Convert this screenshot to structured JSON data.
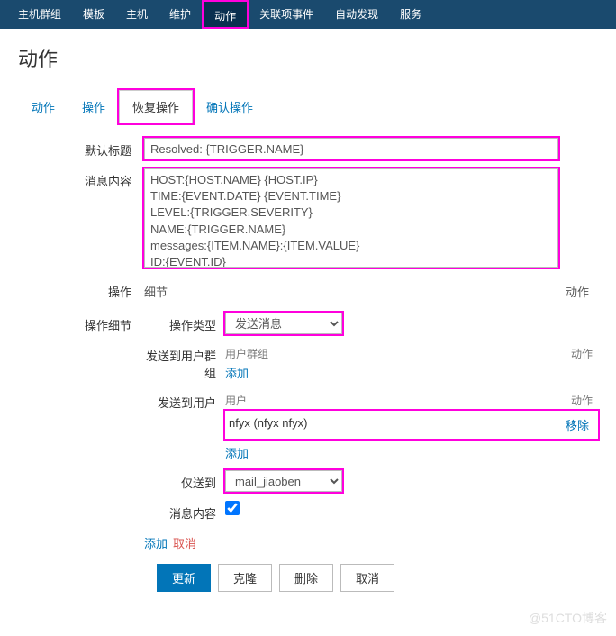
{
  "topnav": [
    "主机群组",
    "模板",
    "主机",
    "维护",
    "动作",
    "关联项事件",
    "自动发现",
    "服务"
  ],
  "topnav_active": 4,
  "page_title": "动作",
  "tabs": [
    "动作",
    "操作",
    "恢复操作",
    "确认操作"
  ],
  "tabs_active": 2,
  "form": {
    "default_title_label": "默认标题",
    "default_title_value": "Resolved: {TRIGGER.NAME}",
    "message_label": "消息内容",
    "message_value": "HOST:{HOST.NAME} {HOST.IP}\nTIME:{EVENT.DATE} {EVENT.TIME}\nLEVEL:{TRIGGER.SEVERITY}\nNAME:{TRIGGER.NAME}\nmessages:{ITEM.NAME}:{ITEM.VALUE}\nID:{EVENT.ID}",
    "ops_label": "操作",
    "ops_col_detail": "细节",
    "ops_col_action": "动作",
    "detail_label": "操作细节",
    "op_type_label": "操作类型",
    "op_type_value": "发送消息",
    "send_groups_label": "发送到用户群组",
    "col_usergroup": "用户群组",
    "col_action": "动作",
    "add_link": "添加",
    "send_users_label": "发送到用户",
    "col_user": "用户",
    "user_row": {
      "name": "nfyx (nfyx nfyx)",
      "remove": "移除"
    },
    "only_to_label": "仅送到",
    "only_to_value": "mail_jiaoben",
    "msg_content_label": "消息内容",
    "msg_content_checked": true,
    "add_text": "添加",
    "cancel_text": "取消"
  },
  "buttons": {
    "update": "更新",
    "clone": "克隆",
    "delete": "删除",
    "cancel": "取消"
  },
  "watermark": "@51CTO博客"
}
